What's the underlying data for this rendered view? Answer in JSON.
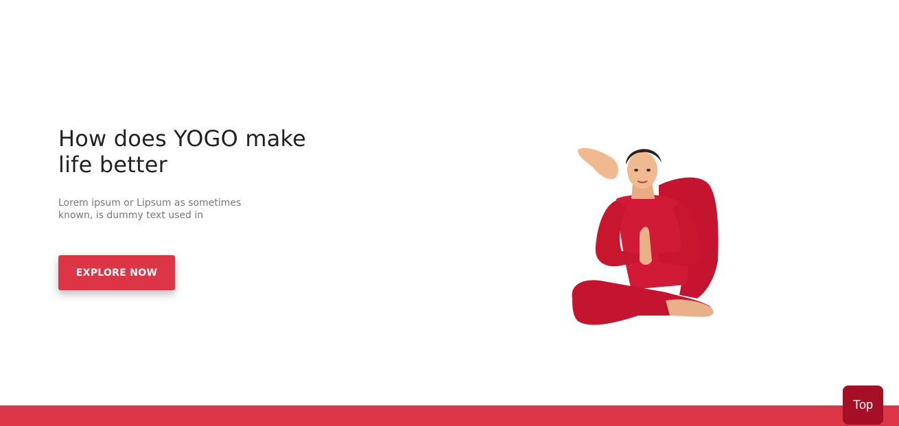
{
  "hero": {
    "title": "How does YOGO make life better",
    "text": "Lorem ipsum or Lipsum as sometimes known, is dummy text used in",
    "button_label": "EXPLORE NOW"
  },
  "back_to_top": {
    "label": "Top"
  },
  "colors": {
    "accent": "#dc3545",
    "top_button": "#a51027",
    "title_text": "#222222",
    "body_text": "#777777"
  },
  "image": {
    "icon": "yoga-pose-illustration"
  }
}
